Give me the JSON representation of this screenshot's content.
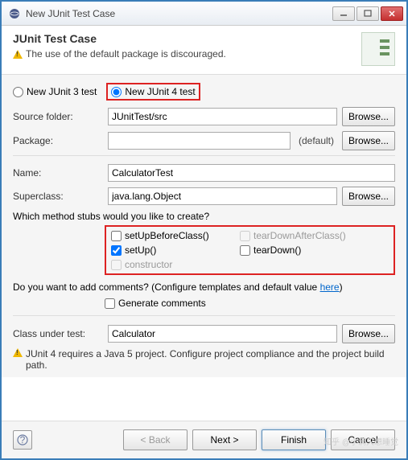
{
  "window": {
    "title": "New JUnit Test Case"
  },
  "banner": {
    "heading": "JUnit Test Case",
    "warning": "The use of the default package is discouraged."
  },
  "radios": {
    "junit3": "New JUnit 3 test",
    "junit4": "New JUnit 4 test"
  },
  "form": {
    "sourceFolder": {
      "label": "Source folder:",
      "value": "JUnitTest/src",
      "browse": "Browse..."
    },
    "package": {
      "label": "Package:",
      "value": "",
      "default": "(default)",
      "browse": "Browse..."
    },
    "name": {
      "label": "Name:",
      "value": "CalculatorTest"
    },
    "superclass": {
      "label": "Superclass:",
      "value": "java.lang.Object",
      "browse": "Browse..."
    }
  },
  "stubs": {
    "question": "Which method stubs would you like to create?",
    "setUpBeforeClass": "setUpBeforeClass()",
    "tearDownAfterClass": "tearDownAfterClass()",
    "setUp": "setUp()",
    "tearDown": "tearDown()",
    "constructor": "constructor"
  },
  "comments": {
    "question_pre": "Do you want to add comments? (Configure templates and default value ",
    "link": "here",
    "question_post": ")",
    "generate": "Generate comments"
  },
  "classUnderTest": {
    "label": "Class under test:",
    "value": "Calculator",
    "browse": "Browse..."
  },
  "warning2": {
    "pre": "JUnit 4 requires a Java 5 project. ",
    "link": "Configure",
    "post": " project compliance and the project build path."
  },
  "footer": {
    "back": "< Back",
    "next": "Next >",
    "finish": "Finish",
    "cancel": "Cancel"
  },
  "watermark": "知乎 @小满只想睡觉"
}
